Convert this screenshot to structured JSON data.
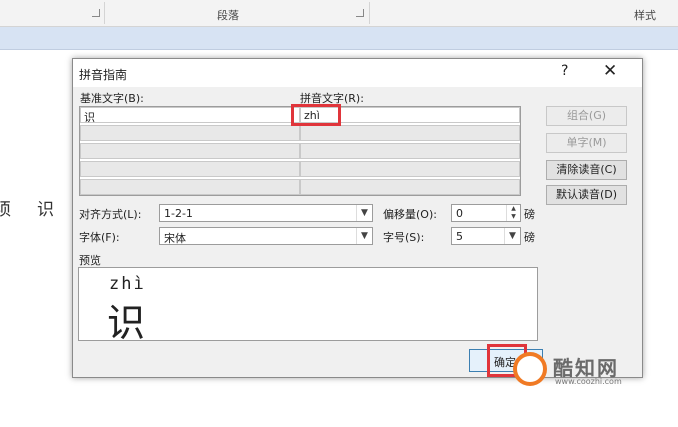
{
  "ribbon": {
    "groups": [
      "段落",
      "样式"
    ]
  },
  "document": {
    "chars": [
      "须",
      "识"
    ]
  },
  "dialog": {
    "title": "拼音指南",
    "help": "?",
    "close": "✕",
    "base_text_label": "基准文字(B):",
    "pinyin_text_label": "拼音文字(R):",
    "base_text_value": "识",
    "pinyin_text_value": "zhì",
    "buttons": {
      "group": "组合(G)",
      "single": "单字(M)",
      "clear": "清除读音(C)",
      "default": "默认读音(D)"
    },
    "alignment_label": "对齐方式(L):",
    "alignment_value": "1-2-1",
    "offset_label": "偏移量(O):",
    "offset_value": "0",
    "offset_unit": "磅",
    "font_label": "字体(F):",
    "font_value": "宋体",
    "size_label": "字号(S):",
    "size_value": "5",
    "size_unit": "磅",
    "preview_label": "预览",
    "preview_pinyin": "zhì",
    "preview_char": "识",
    "ok_label": "确定"
  },
  "watermark": {
    "text": "酷知网",
    "url": "www.coozhi.com"
  },
  "colors": {
    "highlight": "#e0353b",
    "ruler": "#d7e3f3"
  }
}
